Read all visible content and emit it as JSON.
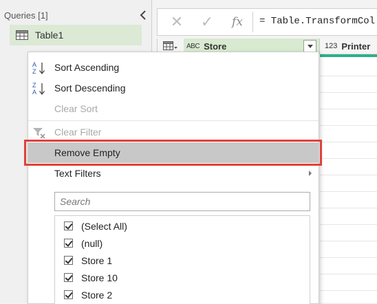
{
  "queries": {
    "header": "Queries [1]",
    "items": [
      {
        "label": "Table1"
      }
    ]
  },
  "formula": {
    "text": "= Table.TransformCol",
    "cancel_icon": "✕",
    "accept_icon": "✓",
    "fx_label": "fx"
  },
  "columns": [
    {
      "type_icon": "ABC",
      "name": "Store"
    },
    {
      "type_icon": "123",
      "name": "Printer"
    }
  ],
  "menu": {
    "items": [
      {
        "label": "Sort Ascending",
        "icon": "sort-ascending-icon",
        "disabled": false
      },
      {
        "label": "Sort Descending",
        "icon": "sort-descending-icon",
        "disabled": false
      },
      {
        "label": "Clear Sort",
        "disabled": true
      },
      {
        "label": "Clear Filter",
        "icon": "clear-filter-icon",
        "disabled": true
      },
      {
        "label": "Remove Empty",
        "disabled": false,
        "highlighted": true
      },
      {
        "label": "Text Filters",
        "disabled": false,
        "has_submenu": true
      }
    ],
    "search_placeholder": "Search",
    "filter_values": [
      {
        "label": "(Select All)",
        "checked": true
      },
      {
        "label": "(null)",
        "checked": true
      },
      {
        "label": "Store 1",
        "checked": true
      },
      {
        "label": "Store 10",
        "checked": true
      },
      {
        "label": "Store 2",
        "checked": true
      }
    ]
  },
  "colors": {
    "selected_query_bg": "#dbe9d5",
    "column_header_active": "#d8ead0",
    "quality_bar": "#2bb08a",
    "annotation_box": "#e0413b",
    "hover_bg": "#c8c8c8"
  }
}
